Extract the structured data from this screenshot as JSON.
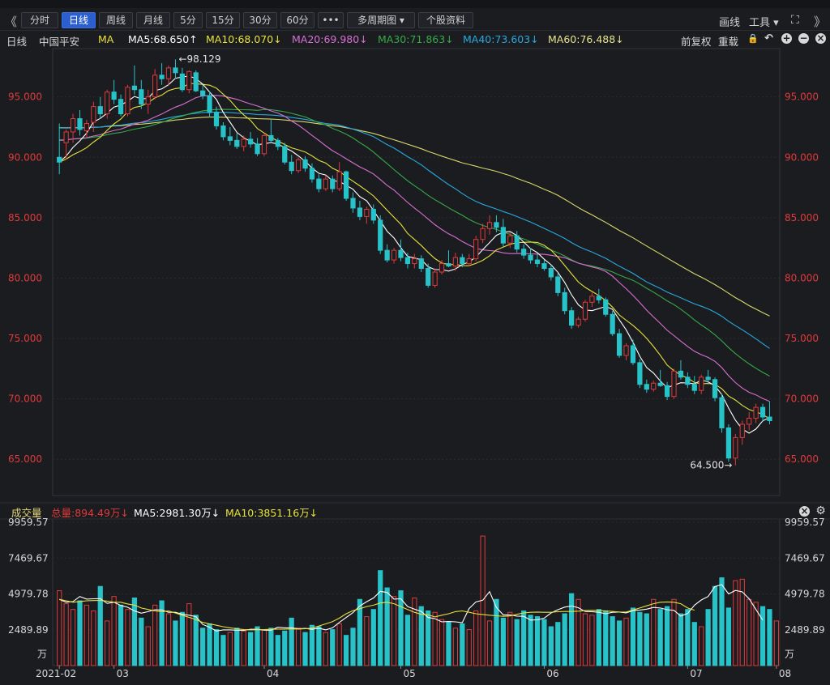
{
  "toolbar": {
    "nav_left": "《",
    "tabs": [
      {
        "label": "分时",
        "active": false
      },
      {
        "label": "日线",
        "active": true
      },
      {
        "label": "周线",
        "active": false
      },
      {
        "label": "月线",
        "active": false
      },
      {
        "label": "5分",
        "active": false
      },
      {
        "label": "15分",
        "active": false
      },
      {
        "label": "30分",
        "active": false
      },
      {
        "label": "60分",
        "active": false
      },
      {
        "label": "•••",
        "active": false
      },
      {
        "label": "多周期图 ▾",
        "active": false
      },
      {
        "label": "个股资料",
        "active": false
      }
    ],
    "draw_label": "画线",
    "tools_label": "工具 ▾",
    "fullscreen_icon": "expand-icon",
    "nav_right": "》"
  },
  "legend": {
    "period": "日线",
    "stock_name": "中国平安",
    "indicator": "MA",
    "ma5": "MA5:68.650↑",
    "ma10": "MA10:68.070↓",
    "ma20": "MA20:69.980↓",
    "ma30": "MA30:71.863↓",
    "ma40": "MA40:73.603↓",
    "ma60": "MA60:76.488↓",
    "adjust": "前复权",
    "overlay": "重载",
    "icons": [
      "lock-icon",
      "undo-icon",
      "zoom-in-icon",
      "zoom-out-icon",
      "close-icon"
    ]
  },
  "volume_legend": {
    "title": "成交量",
    "total": "总量:894.49万↓",
    "ma5": "MA5:2981.30万↓",
    "ma10": "MA10:3851.16万↓",
    "icons": [
      "close-icon",
      "gear-icon"
    ]
  },
  "colors": {
    "up": "#e03a3a",
    "down": "#27c3c9",
    "ma5": "#ffffff",
    "ma10": "#e7e23b",
    "ma20": "#d86fd3",
    "ma30": "#37a946",
    "ma40": "#27a9df",
    "ma60": "#d8d86a",
    "price_axis": "#e03a3a",
    "grid": "#2a2b30"
  },
  "chart_data": [
    {
      "type": "candlestick",
      "title": "中国平安 日线",
      "y_axis_labels": [
        "95.000",
        "90.000",
        "85.000",
        "80.000",
        "75.000",
        "70.000",
        "65.000"
      ],
      "y_ticks": [
        95,
        90,
        85,
        80,
        75,
        70,
        65
      ],
      "ylim": [
        62.0,
        99.0
      ],
      "annotations": [
        {
          "label": "←98.129",
          "value": 98.129
        },
        {
          "label": "64.500→",
          "value": 64.5
        }
      ],
      "ohlc": [
        [
          90.0,
          92.8,
          88.6,
          89.6
        ],
        [
          91.2,
          92.3,
          89.8,
          92.1
        ],
        [
          92.1,
          93.6,
          91.2,
          93.2
        ],
        [
          93.2,
          93.9,
          91.8,
          92.3
        ],
        [
          92.2,
          93.1,
          91.6,
          92.8
        ],
        [
          92.9,
          94.6,
          92.1,
          94.2
        ],
        [
          94.2,
          95.0,
          93.2,
          93.6
        ],
        [
          93.6,
          95.6,
          93.2,
          95.4
        ],
        [
          95.4,
          96.4,
          94.4,
          94.8
        ],
        [
          94.8,
          95.2,
          93.4,
          93.6
        ],
        [
          93.6,
          96.0,
          93.4,
          95.8
        ],
        [
          95.9,
          97.6,
          95.2,
          95.6
        ],
        [
          95.6,
          96.4,
          94.0,
          94.4
        ],
        [
          94.4,
          95.6,
          93.6,
          95.0
        ],
        [
          95.0,
          97.3,
          94.8,
          96.8
        ],
        [
          96.8,
          97.8,
          96.0,
          96.5
        ],
        [
          96.5,
          97.6,
          95.9,
          97.4
        ],
        [
          97.4,
          98.1,
          96.5,
          97.0
        ],
        [
          96.9,
          97.4,
          95.4,
          95.6
        ],
        [
          95.6,
          97.2,
          95.3,
          97.1
        ],
        [
          97.0,
          97.2,
          95.4,
          95.5
        ],
        [
          95.5,
          96.0,
          94.8,
          95.1
        ],
        [
          95.1,
          95.5,
          93.3,
          93.7
        ],
        [
          93.7,
          94.2,
          92.3,
          92.6
        ],
        [
          92.6,
          92.9,
          91.4,
          91.7
        ],
        [
          91.7,
          92.5,
          91.0,
          91.4
        ],
        [
          91.4,
          92.0,
          90.7,
          90.9
        ],
        [
          90.9,
          91.8,
          90.5,
          91.5
        ],
        [
          91.5,
          92.1,
          90.8,
          91.1
        ],
        [
          91.1,
          91.6,
          90.1,
          90.3
        ],
        [
          90.3,
          92.0,
          90.1,
          91.8
        ],
        [
          91.8,
          93.1,
          91.2,
          91.4
        ],
        [
          91.4,
          91.6,
          90.6,
          90.9
        ],
        [
          90.9,
          91.2,
          89.4,
          89.6
        ],
        [
          89.6,
          90.2,
          88.6,
          88.9
        ],
        [
          88.9,
          90.0,
          88.7,
          89.8
        ],
        [
          89.8,
          90.1,
          88.8,
          89.1
        ],
        [
          89.1,
          89.5,
          87.9,
          88.2
        ],
        [
          88.2,
          88.6,
          87.1,
          87.4
        ],
        [
          87.4,
          88.5,
          87.2,
          88.2
        ],
        [
          88.2,
          88.5,
          87.1,
          87.4
        ],
        [
          87.4,
          89.6,
          87.2,
          88.8
        ],
        [
          88.8,
          88.9,
          86.4,
          86.6
        ],
        [
          86.6,
          87.1,
          85.4,
          85.8
        ],
        [
          85.8,
          86.4,
          84.8,
          85.1
        ],
        [
          85.1,
          85.9,
          84.5,
          85.7
        ],
        [
          85.7,
          86.1,
          84.5,
          84.8
        ],
        [
          84.8,
          85.2,
          82.0,
          82.3
        ],
        [
          82.3,
          82.8,
          81.3,
          81.5
        ],
        [
          81.5,
          82.5,
          81.2,
          82.3
        ],
        [
          82.3,
          83.2,
          81.4,
          81.7
        ],
        [
          81.7,
          82.1,
          80.8,
          81.2
        ],
        [
          81.2,
          82.0,
          80.8,
          81.6
        ],
        [
          81.6,
          81.9,
          80.5,
          80.8
        ],
        [
          80.8,
          81.2,
          79.2,
          79.4
        ],
        [
          79.4,
          80.8,
          79.2,
          80.5
        ],
        [
          80.5,
          81.5,
          80.3,
          81.2
        ],
        [
          81.2,
          82.3,
          80.9,
          81.0
        ],
        [
          81.0,
          82.1,
          80.6,
          81.7
        ],
        [
          81.7,
          82.0,
          80.9,
          81.2
        ],
        [
          81.2,
          82.0,
          81.0,
          81.6
        ],
        [
          81.6,
          83.5,
          81.4,
          83.2
        ],
        [
          83.2,
          84.5,
          82.9,
          84.1
        ],
        [
          84.1,
          85.2,
          83.6,
          84.6
        ],
        [
          84.6,
          85.2,
          83.8,
          84.2
        ],
        [
          84.2,
          84.9,
          82.6,
          82.9
        ],
        [
          82.9,
          83.8,
          82.5,
          83.5
        ],
        [
          83.5,
          83.9,
          82.1,
          82.4
        ],
        [
          82.4,
          82.8,
          81.6,
          81.9
        ],
        [
          81.9,
          82.5,
          81.2,
          81.5
        ],
        [
          81.5,
          82.0,
          80.9,
          81.2
        ],
        [
          81.2,
          81.5,
          80.6,
          80.8
        ],
        [
          80.8,
          81.1,
          79.8,
          80.1
        ],
        [
          80.1,
          80.4,
          78.5,
          78.8
        ],
        [
          78.8,
          79.2,
          77.0,
          77.3
        ],
        [
          77.3,
          77.6,
          75.8,
          76.1
        ],
        [
          76.1,
          76.8,
          75.9,
          76.6
        ],
        [
          76.6,
          78.2,
          76.4,
          78.0
        ],
        [
          78.0,
          78.8,
          77.6,
          78.5
        ],
        [
          78.5,
          79.1,
          77.9,
          78.2
        ],
        [
          78.2,
          78.4,
          76.8,
          77.0
        ],
        [
          77.0,
          77.3,
          75.2,
          75.4
        ],
        [
          75.4,
          75.8,
          73.4,
          73.6
        ],
        [
          73.6,
          74.6,
          73.2,
          74.4
        ],
        [
          74.4,
          74.9,
          72.8,
          73.0
        ],
        [
          73.0,
          73.3,
          70.9,
          71.2
        ],
        [
          71.2,
          71.6,
          70.5,
          70.8
        ],
        [
          70.8,
          71.5,
          70.6,
          71.3
        ],
        [
          71.3,
          72.4,
          71.0,
          71.1
        ],
        [
          71.1,
          71.4,
          69.9,
          70.2
        ],
        [
          70.2,
          72.5,
          70.0,
          72.3
        ],
        [
          72.3,
          73.2,
          71.6,
          71.8
        ],
        [
          71.8,
          72.2,
          70.9,
          71.2
        ],
        [
          71.2,
          71.9,
          70.4,
          70.7
        ],
        [
          70.7,
          72.0,
          70.4,
          71.8
        ],
        [
          71.8,
          72.4,
          71.2,
          71.6
        ],
        [
          71.6,
          71.8,
          69.8,
          70.1
        ],
        [
          70.1,
          70.4,
          67.2,
          67.6
        ],
        [
          67.6,
          67.9,
          64.8,
          65.1
        ],
        [
          65.1,
          67.1,
          64.5,
          66.8
        ],
        [
          66.8,
          68.2,
          66.2,
          67.9
        ],
        [
          67.9,
          68.9,
          67.4,
          68.4
        ],
        [
          68.4,
          69.6,
          68.0,
          69.3
        ],
        [
          69.3,
          69.6,
          68.1,
          68.5
        ],
        [
          68.5,
          69.8,
          67.9,
          68.2
        ]
      ],
      "x_labels": [
        {
          "label": "2021-02",
          "index": 0
        },
        {
          "label": "03",
          "index": 8
        },
        {
          "label": "04",
          "index": 30
        },
        {
          "label": "05",
          "index": 50
        },
        {
          "label": "06",
          "index": 71
        },
        {
          "label": "07",
          "index": 92
        },
        {
          "label": "08",
          "index": 105
        }
      ]
    },
    {
      "type": "bar",
      "title": "成交量",
      "unit": "万",
      "y_axis_labels": [
        "9959.57",
        "7469.67",
        "4979.78",
        "2489.89",
        "万"
      ],
      "y_ticks": [
        9959.57,
        7469.67,
        4979.78,
        2489.89
      ],
      "ylim": [
        0,
        9959.57
      ],
      "values": [
        5200,
        4300,
        3900,
        4500,
        4200,
        3800,
        5500,
        3100,
        4800,
        4200,
        3900,
        4700,
        3300,
        2700,
        4200,
        4500,
        3600,
        3100,
        3700,
        4300,
        3500,
        2600,
        2900,
        2500,
        2100,
        2300,
        2600,
        2400,
        2300,
        2700,
        2500,
        2600,
        2100,
        2400,
        3300,
        2600,
        2300,
        2800,
        2700,
        2300,
        2500,
        2900,
        2100,
        2600,
        4600,
        3400,
        3900,
        6600,
        5400,
        4800,
        5200,
        3500,
        4700,
        4100,
        3800,
        3700,
        3200,
        3000,
        2600,
        2900,
        2500,
        3800,
        9000,
        3100,
        4600,
        3300,
        3700,
        3200,
        3800,
        3500,
        3400,
        3200,
        2700,
        3000,
        3600,
        5000,
        4600,
        3600,
        3500,
        3900,
        3800,
        3400,
        3100,
        3300,
        4000,
        3700,
        3600,
        4600,
        3900,
        4100,
        4600,
        3600,
        3900,
        3000,
        2700,
        3900,
        5500,
        6100,
        4000,
        5900,
        6000,
        4600,
        4400,
        4100,
        3900,
        3100
      ],
      "up_flags": [
        1,
        1,
        1,
        0,
        1,
        1,
        0,
        1,
        1,
        0,
        1,
        0,
        0,
        1,
        1,
        0,
        1,
        0,
        0,
        1,
        0,
        0,
        0,
        0,
        0,
        1,
        0,
        1,
        0,
        0,
        1,
        0,
        0,
        0,
        0,
        1,
        0,
        0,
        0,
        1,
        0,
        1,
        0,
        0,
        0,
        1,
        0,
        0,
        0,
        1,
        0,
        0,
        1,
        0,
        0,
        1,
        1,
        0,
        1,
        0,
        1,
        1,
        1,
        1,
        0,
        0,
        1,
        0,
        0,
        0,
        0,
        0,
        0,
        0,
        0,
        0,
        1,
        1,
        1,
        0,
        0,
        0,
        0,
        1,
        0,
        0,
        0,
        1,
        0,
        0,
        1,
        0,
        0,
        0,
        1,
        0,
        0,
        0,
        0,
        1,
        1,
        1,
        1,
        0,
        0,
        1
      ],
      "ma5": [
        4600,
        4400,
        4450,
        4800,
        4620,
        4640,
        4650,
        4320,
        4400,
        4180,
        4050,
        3800,
        3640,
        3750,
        3880,
        3860,
        3700,
        3700,
        3560,
        3500,
        3400,
        2860,
        2660,
        2400,
        2480,
        2480,
        2460,
        2440,
        2520,
        2520,
        2460,
        2460,
        2660,
        2620,
        2620,
        2560,
        2580,
        2520,
        2600,
        2480,
        2620,
        3000,
        3340,
        3680,
        4140,
        4440,
        4700,
        5160,
        5080,
        4620,
        4640,
        4100,
        3920,
        3760,
        3340,
        3260,
        3040,
        3060,
        3040,
        2980,
        3960,
        4420,
        4540,
        5140,
        4040,
        3520,
        3520,
        3440,
        3420,
        3160,
        3180,
        3300,
        3660,
        3880,
        4060,
        4140,
        4020,
        3760,
        3740,
        3700,
        3600,
        3700,
        3720,
        3660,
        3820,
        3860,
        3920,
        4040,
        4000,
        3880,
        3840,
        3440,
        3620,
        4200,
        4560,
        4800,
        5500,
        5620,
        4980,
        5220,
        5120,
        4640,
        3900,
        3160
      ],
      "ma10": [
        4600,
        4500,
        4400,
        4450,
        4500,
        4520,
        4530,
        4480,
        4400,
        4400,
        4280,
        4200,
        4000,
        3900,
        3800,
        3750,
        3800,
        3650,
        3500,
        3350,
        3200,
        3000,
        2900,
        2800,
        2700,
        2620,
        2560,
        2500,
        2480,
        2490,
        2500,
        2520,
        2530,
        2530,
        2550,
        2540,
        2560,
        2600,
        2750,
        2900,
        3050,
        3300,
        3600,
        3820,
        3950,
        4100,
        4200,
        4350,
        4400,
        4300,
        4100,
        3900,
        3700,
        3560,
        3520,
        3380,
        3500,
        3600,
        3750,
        3800,
        3700,
        3600,
        3550,
        3500,
        3460,
        3420,
        3450,
        3560,
        3660,
        3700,
        3720,
        3700,
        3700,
        3740,
        3760,
        3760,
        3780,
        3820,
        3840,
        3820,
        3800,
        3760,
        3720,
        3720,
        3860,
        4000,
        4150,
        4300,
        4400,
        4420,
        4400,
        4300,
        4000,
        3850
      ]
    }
  ]
}
